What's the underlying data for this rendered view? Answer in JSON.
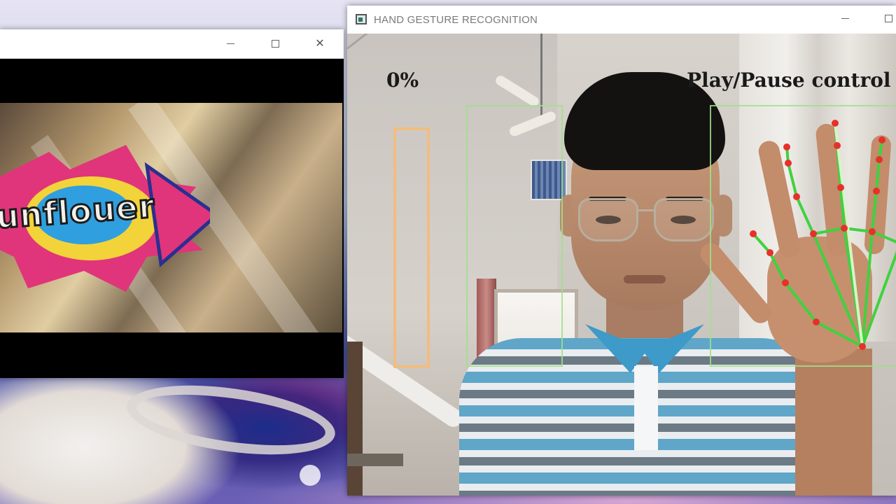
{
  "player_window": {
    "title": "",
    "video_logo_text": "unflouer"
  },
  "gesture_window": {
    "title": "HAND GESTURE RECOGNITION",
    "volume_percent_label": "0%",
    "volume_level": 0,
    "mode_label": "Play/Pause  control"
  },
  "icons": {
    "minimize": "minimize-icon",
    "maximize": "maximize-icon",
    "close": "close-icon",
    "app": "app-window-icon"
  },
  "colors": {
    "volume_bar": "#f1bd80",
    "zone_box": "#9fe08a",
    "landmark_line": "#3fd23f",
    "landmark_point": "#e8302a"
  }
}
